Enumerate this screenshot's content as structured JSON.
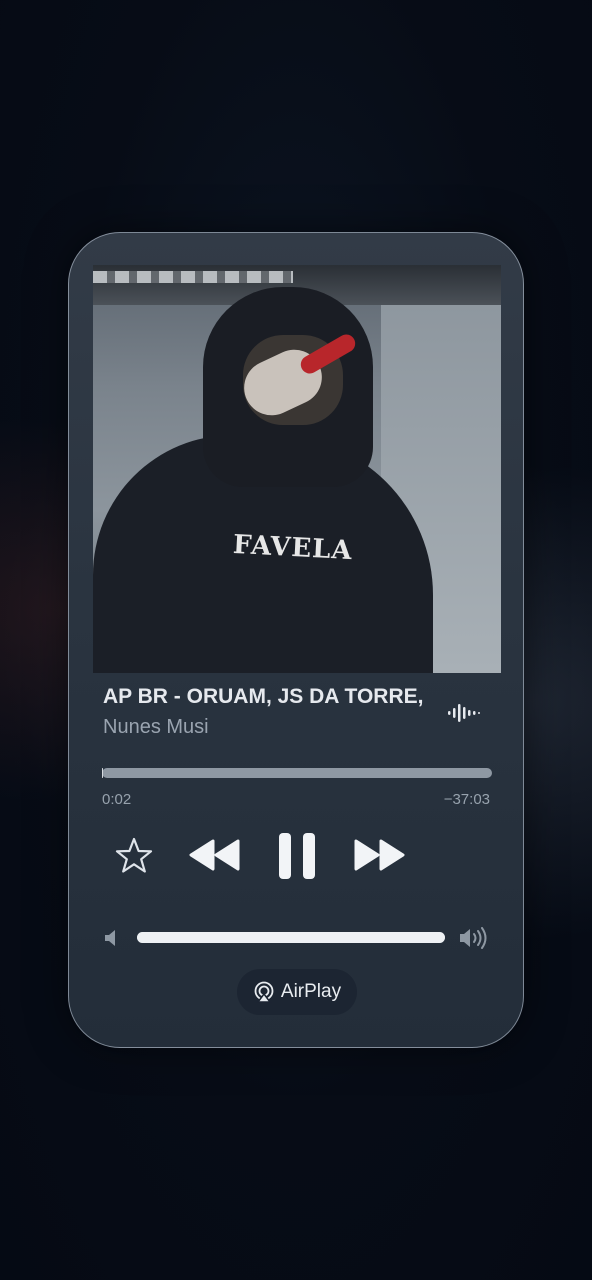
{
  "now_playing": {
    "title": "AP BR - ORUAM, JS DA TORRE,",
    "artist": "Nunes Musi",
    "artwork_text": "FAVELA"
  },
  "progress": {
    "elapsed": "0:02",
    "remaining": "−37:03",
    "fraction": 0.001
  },
  "controls": {
    "favorite_icon": "star-icon",
    "rewind_icon": "rewind-icon",
    "pause_icon": "pause-icon",
    "forward_icon": "fast-forward-icon"
  },
  "volume": {
    "level": 1.0
  },
  "airplay": {
    "label": "AirPlay"
  },
  "colors": {
    "accent": "#e6e9ee",
    "secondary_text": "#9aa4b0",
    "card_background": "#2a3440"
  }
}
